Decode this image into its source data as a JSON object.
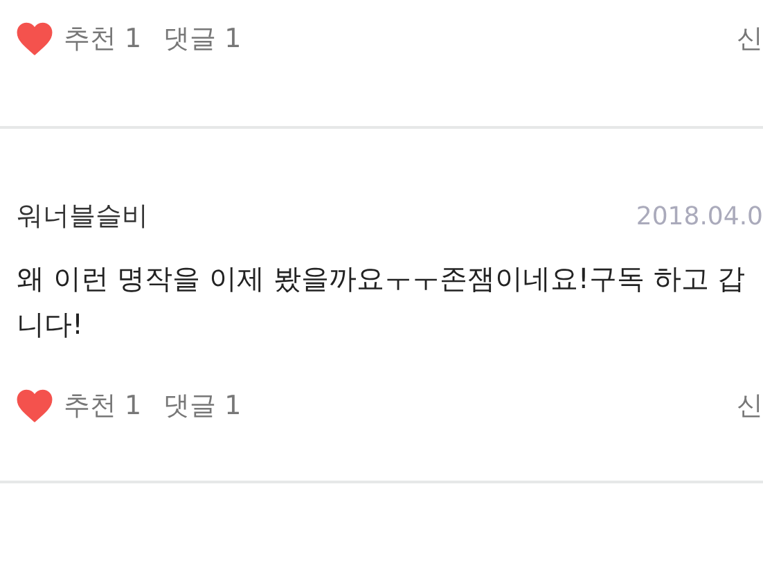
{
  "comments": [
    {
      "actions": {
        "liked": true,
        "like_label": "추천",
        "like_count": "1",
        "reply_label": "댓글",
        "reply_count": "1",
        "report_label": "신"
      }
    },
    {
      "author": "워너블슬비",
      "date": "2018.04.0",
      "body": "왜 이런 명작을 이제 봤을까요ㅜㅜ존잼이네요!구독 하고 갑니다!",
      "actions": {
        "liked": true,
        "like_label": "추천",
        "like_count": "1",
        "reply_label": "댓글",
        "reply_count": "1",
        "report_label": "신"
      }
    }
  ]
}
